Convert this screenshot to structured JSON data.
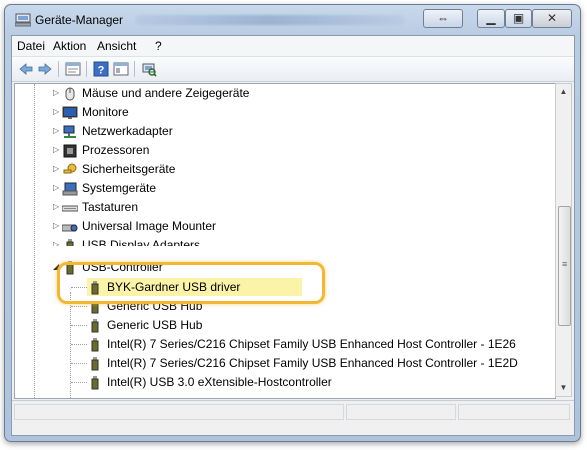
{
  "window": {
    "title": "Geräte-Manager"
  },
  "menubar": [
    "Datei",
    "Aktion",
    "Ansicht",
    "?"
  ],
  "toolbar": {
    "icons": [
      "back-arrow-icon",
      "forward-arrow-icon",
      "properties-icon",
      "help-icon",
      "view-icon",
      "scan-hardware-icon"
    ]
  },
  "tree": {
    "items": [
      {
        "label": "Mäuse und andere Zeigegeräte",
        "icon": "mouse-icon",
        "expander": "▷"
      },
      {
        "label": "Monitore",
        "icon": "monitor-icon",
        "expander": "▷"
      },
      {
        "label": "Netzwerkadapter",
        "icon": "network-icon",
        "expander": "▷"
      },
      {
        "label": "Prozessoren",
        "icon": "processor-icon",
        "expander": "▷"
      },
      {
        "label": "Sicherheitsgeräte",
        "icon": "security-key-icon",
        "expander": "▷"
      },
      {
        "label": "Systemgeräte",
        "icon": "system-device-icon",
        "expander": "▷"
      },
      {
        "label": "Tastaturen",
        "icon": "keyboard-icon",
        "expander": "▷"
      },
      {
        "label": "Universal Image Mounter",
        "icon": "drive-icon",
        "expander": "▷"
      },
      {
        "label": "USB Display Adapters",
        "icon": "usb-icon",
        "expander": "▷"
      },
      {
        "label": "USB-Controller",
        "icon": "usb-icon",
        "expander": "◢"
      }
    ],
    "usb_children": [
      "BYK-Gardner USB driver",
      "Generic USB Hub",
      "Generic USB Hub",
      "Intel(R) 7 Series/C216 Chipset Family USB Enhanced Host Controller - 1E26",
      "Intel(R) 7 Series/C216 Chipset Family USB Enhanced Host Controller - 1E2D",
      "Intel(R) USB 3.0 eXtensible-Hostcontroller"
    ],
    "highlighted_item": "BYK-Gardner USB driver"
  },
  "colors": {
    "highlight_fill": "#fbf3a8",
    "callout_border": "#f3b733"
  }
}
